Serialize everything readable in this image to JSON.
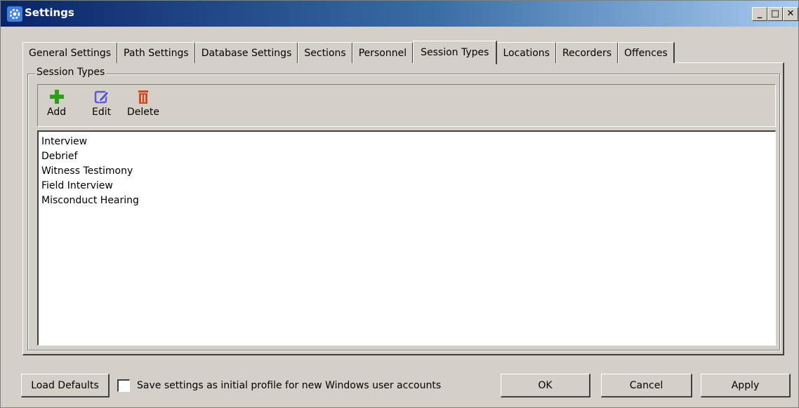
{
  "window": {
    "title": "Settings",
    "icon": "gear-icon",
    "controls": {
      "minimize": "_",
      "maximize": "□",
      "close": "✕"
    }
  },
  "tabs": [
    {
      "label": "General Settings",
      "active": false
    },
    {
      "label": "Path Settings",
      "active": false
    },
    {
      "label": "Database Settings",
      "active": false
    },
    {
      "label": "Sections",
      "active": false
    },
    {
      "label": "Personnel",
      "active": false
    },
    {
      "label": "Session Types",
      "active": true
    },
    {
      "label": "Locations",
      "active": false
    },
    {
      "label": "Recorders",
      "active": false
    },
    {
      "label": "Offences",
      "active": false
    }
  ],
  "group": {
    "title": "Session Types",
    "toolbar": {
      "add_label": "Add",
      "edit_label": "Edit",
      "delete_label": "Delete",
      "colors": {
        "add": "#2e9e1a",
        "edit": "#5a5ad6",
        "delete": "#d8461c"
      }
    },
    "items": [
      "Interview",
      "Debrief",
      "Witness Testimony",
      "Field Interview",
      "Misconduct Hearing"
    ]
  },
  "footer": {
    "load_defaults_label": "Load Defaults",
    "checkbox_label": "Save settings as initial profile for new Windows user accounts",
    "checkbox_checked": false,
    "ok_label": "OK",
    "cancel_label": "Cancel",
    "apply_label": "Apply"
  }
}
